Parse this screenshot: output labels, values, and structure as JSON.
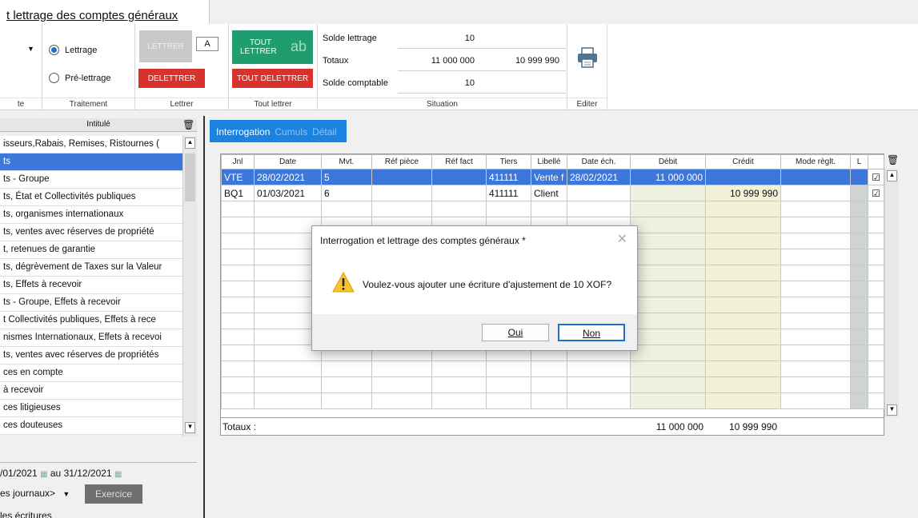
{
  "window": {
    "title": "t lettrage des comptes généraux"
  },
  "ribbon": {
    "groups": {
      "left_partial": "te",
      "traitement": "Traitement",
      "lettrer": "Lettrer",
      "tout_lettrer": "Tout lettrer",
      "situation": "Situation",
      "editer": "Editer"
    },
    "traitement": {
      "lettrage": "Lettrage",
      "pre_lettrage": "Pré-lettrage",
      "selected": "Lettrage"
    },
    "lettrer": {
      "lettrer_btn": "LETTRER",
      "letter_code": "A",
      "delettrer_btn": "DELETTRER"
    },
    "tout_lettrer": {
      "tout_lettrer_btn_line1": "TOUT",
      "tout_lettrer_btn_line2": "LETTRER",
      "ab_glyph": "ab",
      "tout_delettrer_btn": "TOUT DELETTRER"
    },
    "situation": {
      "solde_lettrage_label": "Solde lettrage",
      "solde_lettrage_value": "10",
      "totaux_label": "Totaux",
      "totaux_debit": "11 000 000",
      "totaux_credit": "10 999 990",
      "solde_comptable_label": "Solde comptable",
      "solde_comptable_value": "10"
    }
  },
  "accounts": {
    "header": "Intitulé",
    "first_row": "isseurs,Rabais, Remises, Ristournes (",
    "items": [
      "ts",
      "ts - Groupe",
      "ts, État et Collectivités publiques",
      "ts, organismes internationaux",
      "ts, ventes avec réserves de propriété",
      "t, retenues de garantie",
      "ts, dégrèvement de Taxes sur la Valeur",
      "ts, Effets à recevoir",
      "ts - Groupe, Effets à recevoir",
      "t Collectivités publiques, Effets à rece",
      "nismes Internationaux, Effets à recevoi",
      "ts, ventes avec réserves de propriétés",
      "ces en compte",
      "à recevoir",
      "ces litigieuses",
      "ces douteuses"
    ]
  },
  "filters": {
    "date_from": "/01/2021",
    "au": "au",
    "date_to": "31/12/2021",
    "journaux": "es journaux>",
    "exercice": "Exercice",
    "ecritures": "les écritures"
  },
  "tabs": [
    "Interrogation",
    "Cumuls",
    "Détail"
  ],
  "grid": {
    "columns": [
      "Jnl",
      "Date",
      "Mvt.",
      "Réf pièce",
      "Réf fact",
      "Tiers",
      "Libellé",
      "Date éch.",
      "Débit",
      "Crédit",
      "Mode règlt.",
      "L"
    ],
    "rows": [
      {
        "jnl": "VTE",
        "date": "28/02/2021",
        "mvt": "5",
        "ref_piece": "",
        "ref_fact": "",
        "tiers": "411111",
        "libelle": "Vente f",
        "date_ech": "28/02/2021",
        "debit": "11 000 000",
        "credit": "",
        "mode": "",
        "checked": "☑"
      },
      {
        "jnl": "BQ1",
        "date": "01/03/2021",
        "mvt": "6",
        "ref_piece": "",
        "ref_fact": "",
        "tiers": "411111",
        "libelle": "Client",
        "date_ech": "",
        "debit": "",
        "credit": "10 999 990",
        "mode": "",
        "checked": "☑"
      }
    ],
    "totals_label": "Totaux :",
    "totals_debit": "11 000 000",
    "totals_credit": "10 999 990"
  },
  "dialog": {
    "title": "Interrogation et lettrage des comptes généraux *",
    "message": "Voulez-vous ajouter une écriture d'ajustement de 10 XOF?",
    "yes_button": "Oui",
    "no_button": "Non"
  },
  "colors": {
    "accent_blue": "#1c82e0",
    "selection": "#3c77d9",
    "green_btn": "#1f9d6e",
    "red_btn": "#d9312b"
  }
}
